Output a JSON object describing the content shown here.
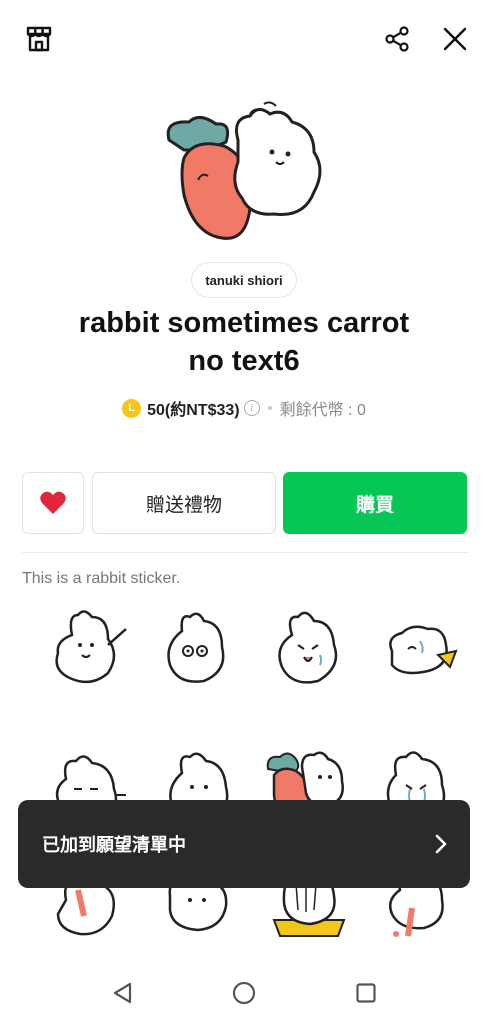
{
  "header": {
    "shop_icon": "shop-icon",
    "share_icon": "share-icon",
    "close_icon": "close-icon"
  },
  "sticker_pack": {
    "author": "tanuki shiori",
    "title_line1": "rabbit sometimes carrot",
    "title_line2": "no text6",
    "coin_symbol": "L",
    "price": "50(約NT$33)",
    "balance": "剩餘代幣 : 0",
    "description": "This is a rabbit sticker."
  },
  "actions": {
    "wishlist_icon": "heart-icon",
    "gift_label": "贈送禮物",
    "buy_label": "購買"
  },
  "toast": {
    "message": "已加到願望清單中",
    "icon": "chevron-right-icon"
  },
  "nav": {
    "back_icon": "back-triangle-icon",
    "home_icon": "home-circle-icon",
    "recents_icon": "recents-square-icon"
  },
  "colors": {
    "brand_green": "#06c755",
    "heart_red": "#e0263a",
    "coin_yellow": "#f5c518",
    "toast_bg": "#2a2a2a"
  }
}
